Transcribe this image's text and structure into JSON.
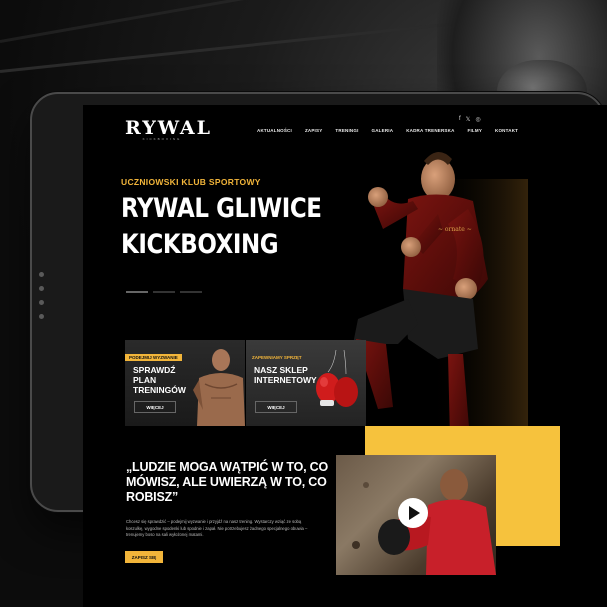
{
  "brand": {
    "logo": "RYWAL",
    "logo_sub": "KICKBOXING"
  },
  "social": {
    "facebook": "f",
    "twitter": "𝕏",
    "instagram": "◎"
  },
  "nav": {
    "items": [
      "AKTUALNOŚCI",
      "ZAPISY",
      "TRENINGI",
      "GALERIA",
      "KADRA TRENERSKA",
      "FILMY",
      "KONTAKT"
    ]
  },
  "hero": {
    "subtitle": "UCZNIOWSKI KLUB SPORTOWY",
    "title_line1": "RYWAL GLIWICE",
    "title_line2": "KICKBOXING"
  },
  "cards": [
    {
      "tag": "PODEJMIJ WYZWANIE",
      "title": "SPRAWDŹ PLAN TRENINGÓW",
      "button": "WIĘCEJ"
    },
    {
      "tag": "ZAPEWNIAMY SPRZĘT",
      "title": "NASZ SKLEP INTERNETOWY",
      "button": "WIĘCEJ"
    }
  ],
  "quote_section": {
    "quote": "„LUDZIE MOGA WĄTPIĆ W TO, CO MÓWISZ, ALE UWIERZĄ W TO, CO ROBISZ”",
    "body": "Chcesz się sprawdzić – podejmij wyzwanie i przyjdź na nasz trening. Wystarczy wziąć ze sobą koszulkę, wygodne spodenki lub spodnie i zapał. Nie potrzebujesz żadnego specjalnego obuwia – trenujemy boso na sali wyłożonej matami.",
    "cta": "ZAPISZ SIĘ"
  },
  "colors": {
    "accent": "#f2b53a",
    "yellow_block": "#f6c23d",
    "background": "#000000"
  },
  "icons": {
    "play": "play-icon"
  }
}
